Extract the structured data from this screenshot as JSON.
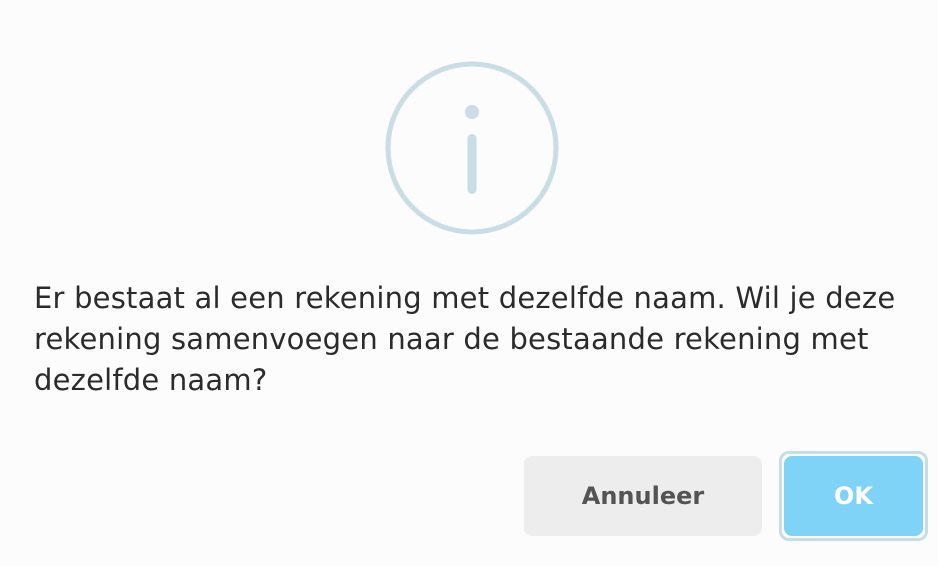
{
  "dialog": {
    "icon": "info-circle-icon",
    "message": "Er bestaat al een rekening met dezelfde naam. Wil je deze rekening samenvoegen naar de bestaande rekening met dezelfde naam?",
    "cancel_label": "Annuleer",
    "ok_label": "OK"
  },
  "colors": {
    "background": "#fcfcfc",
    "icon_stroke": "#c9dde6",
    "text": "#2b2b2b",
    "cancel_bg": "#ededed",
    "cancel_text": "#545454",
    "ok_bg": "#7fd3f7",
    "ok_text": "#ffffff",
    "focus_ring": "#c7dde8"
  }
}
